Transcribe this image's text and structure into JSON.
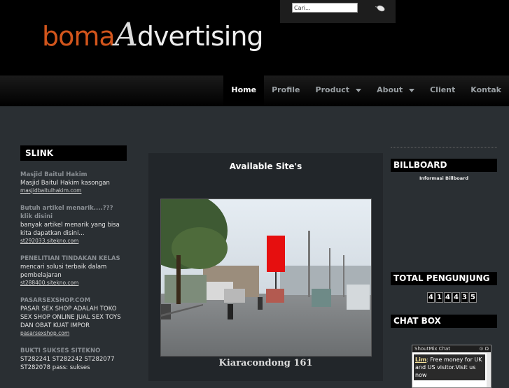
{
  "header": {
    "logo": {
      "part1": "boma",
      "a": "A",
      "part2": "dvertising"
    },
    "search": {
      "value": "Cari..."
    }
  },
  "nav": {
    "items": [
      {
        "label": "Home",
        "active": true,
        "dropdown": false
      },
      {
        "label": "Profile",
        "active": false,
        "dropdown": false
      },
      {
        "label": "Product",
        "active": false,
        "dropdown": true
      },
      {
        "label": "About",
        "active": false,
        "dropdown": true
      },
      {
        "label": "Client",
        "active": false,
        "dropdown": false
      },
      {
        "label": "Kontak",
        "active": false,
        "dropdown": false
      }
    ]
  },
  "slink": {
    "heading": "SLINK",
    "entries": [
      {
        "title": "Masjid Baitul Hakim",
        "desc": "Masjid Baitul Hakim kasongan",
        "url": "masjidbaitulhakim.com"
      },
      {
        "title": "Butuh artikel menarik....??? klik disini",
        "desc": "banyak artikel menarik yang bisa kita dapatkan disini...",
        "url": "st292033.sitekno.com"
      },
      {
        "title": "PENELITIAN TINDAKAN KELAS",
        "desc": "mencari solusi terbaik dalam pembelajaran",
        "url": "st288400.sitekno.com"
      },
      {
        "title": "PASARSEXSHOP.COM",
        "desc": "PASAR SEX SHOP ADALAH TOKO SEX SHOP ONLINE JUAL SEX TOYS DAN OBAT KUAT IMPOR",
        "url": "pasarsexshop.com"
      },
      {
        "title": "BUKTI SUKSES SITEKNO",
        "desc": "ST282241 ST282242 ST282077 ST282078 pass: sukses",
        "url": ""
      }
    ]
  },
  "main": {
    "title": "Available Site's",
    "caption": "Kiaracondong 161"
  },
  "billboard": {
    "heading": "BILLBOARD",
    "info": "Informasi Billboard"
  },
  "visitors": {
    "heading": "TOTAL PENGUNJUNG",
    "digits": [
      "4",
      "1",
      "4",
      "4",
      "3",
      "5"
    ]
  },
  "chat": {
    "heading": "CHAT BOX",
    "widget_title": "ShoutMix Chat",
    "controls": "⊙ Ω",
    "user": "Lim",
    "message": ": Free money for UK and US visitor.Visit us now"
  }
}
